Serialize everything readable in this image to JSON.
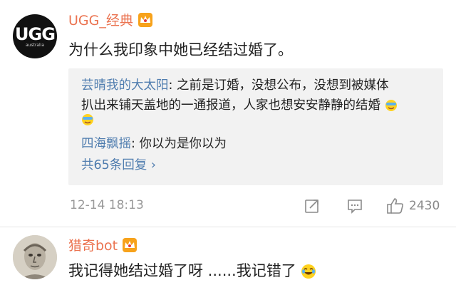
{
  "comments": [
    {
      "username": "UGG_经典",
      "avatar_text": "UGG",
      "avatar_sub": "australia",
      "text": "为什么我印象中她已经结过婚了。",
      "replies": [
        {
          "name": "芸晴我的大太阳",
          "text_line1": ": 之前是订婚，没想公布，没想到被媒体",
          "text_line2": "扒出来铺天盖地的一通报道，人家也想安安静静的结婚"
        },
        {
          "name": "四海飘摇",
          "text_line1": ": 你以为是你以为"
        }
      ],
      "more_replies": "共65条回复 ›",
      "timestamp": "12-14 18:13",
      "like_count": "2430"
    },
    {
      "username": "猎奇bot",
      "text": "我记得她结过婚了呀 ......我记错了"
    }
  ],
  "icons": {
    "crown": "crown-badge-icon",
    "share": "share-icon",
    "comment": "comment-icon",
    "like": "thumbs-up-icon",
    "emoji_face": "emoji-icon",
    "laugh_cry": "laugh-cry-emoji-icon"
  },
  "colors": {
    "username": "#eb7350",
    "link": "#507daf",
    "reply_bg": "#f2f2f2"
  }
}
